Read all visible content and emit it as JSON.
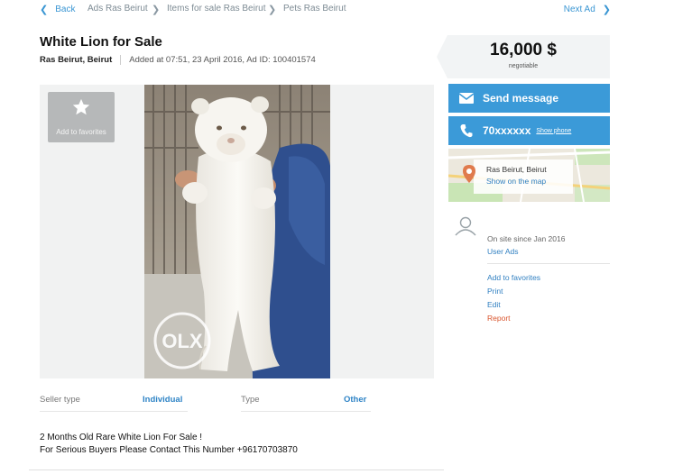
{
  "breadcrumb": {
    "back_label": "Back",
    "items": [
      "Ads Ras Beirut",
      "Items for sale Ras Beirut",
      "Pets Ras Beirut"
    ],
    "next_label": "Next Ad"
  },
  "ad": {
    "title": "White Lion for Sale",
    "location": "Ras Beirut, Beirut",
    "added_text": "Added at 07:51, 23 April 2016, Ad ID: 100401574"
  },
  "price": {
    "amount": "16,000 $",
    "note": "negotiable"
  },
  "gallery": {
    "favorite_label": "Add to favorites",
    "watermark": "OLX"
  },
  "contact": {
    "send_message_label": "Send message",
    "phone_masked": "70xxxxxx",
    "show_phone_label": "Show phone"
  },
  "map": {
    "location": "Ras Beirut, Beirut",
    "show_label": "Show on the map"
  },
  "seller": {
    "since_text": "On site since Jan 2016",
    "user_ads_label": "User Ads"
  },
  "actions": {
    "add_favorites": "Add to favorites",
    "print": "Print",
    "edit": "Edit",
    "report": "Report"
  },
  "details": {
    "seller_type_label": "Seller type",
    "seller_type_value": "Individual",
    "type_label": "Type",
    "type_value": "Other"
  },
  "description": {
    "line1": "2 Months Old Rare White Lion For Sale !",
    "line2": "For Serious Buyers Please Contact This Number +96170703870"
  },
  "colors": {
    "accent_blue": "#3b9ad8",
    "link_blue": "#2f7fc1",
    "report_orange": "#d9532b"
  }
}
